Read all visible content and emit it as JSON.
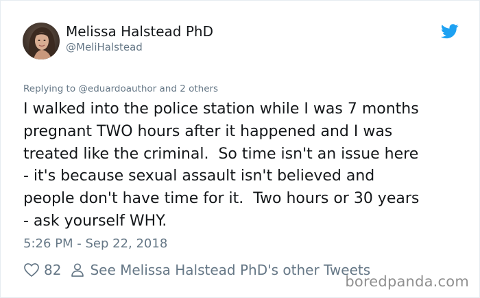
{
  "author": {
    "display_name": "Melissa Halstead PhD",
    "handle": "@MeliHalstead",
    "avatar_icon": "profile-photo"
  },
  "brand": {
    "icon": "twitter-bird-icon",
    "accent_color": "#1da1f2"
  },
  "tweet": {
    "replying_to": "Replying to @eduardoauthor and 2 others",
    "text_lines": [
      "I walked into the police station while I was 7 months",
      "pregnant TWO hours after it happened and I was",
      "treated like the criminal.  So time isn't an issue here",
      "- it's because sexual assault isn't believed and",
      "people don't have time for it.  Two hours or 30 years",
      "- ask yourself WHY."
    ],
    "timestamp": "5:26 PM - Sep 22, 2018"
  },
  "actions": {
    "like_icon": "heart-icon",
    "like_count": "82",
    "profile_icon": "person-icon",
    "other_tweets_label": "See Melissa Halstead PhD's other Tweets"
  },
  "watermark": "boredpanda.com"
}
